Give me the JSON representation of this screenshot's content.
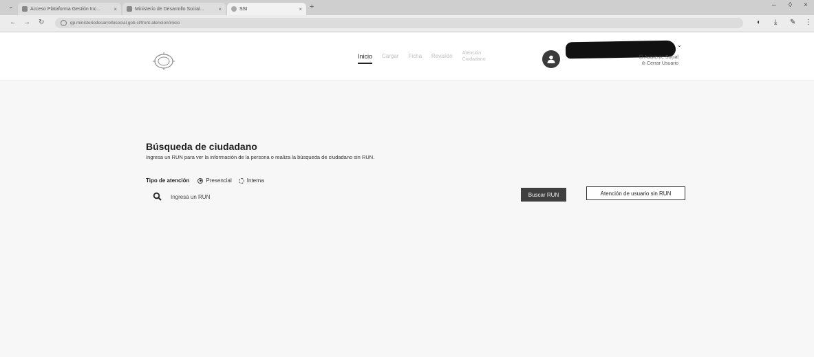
{
  "browser": {
    "tabs": [
      {
        "label": "Acceso Plataforma Gestión Inc..."
      },
      {
        "label": "Ministerio de Desarrollo Social..."
      },
      {
        "label": "SSI"
      }
    ],
    "new_tab": "+",
    "address": "gp.ministeriodesarrollosocial.gob.cl/front-atencion/inicio",
    "window_controls": {
      "minimize": "–",
      "maximize": "◊",
      "close": "×"
    }
  },
  "header": {
    "nav": [
      {
        "label": "Inicio"
      },
      {
        "label": "Cargar"
      },
      {
        "label": "Ficha"
      },
      {
        "label": "Revisión"
      },
      {
        "label_line1": "Atención",
        "label_line2": "Ciudadano"
      }
    ],
    "user_links": [
      "Asistente Social",
      "Cerrar Usuario"
    ]
  },
  "main": {
    "title": "Búsqueda de ciudadano",
    "subtitle": "Ingresa un RUN para ver la información de la persona o realiza la búsqueda de ciudadano sin RUN.",
    "attention_label": "Tipo de atención",
    "options": [
      {
        "label": "Presencial",
        "checked": true
      },
      {
        "label": "Interna",
        "checked": false
      }
    ],
    "search_placeholder": "Ingresa un RUN",
    "search_button": "Buscar RUN",
    "no_run_button": "Atención de usuario sin RUN"
  },
  "colors": {
    "primary_button": "#3f3f3f",
    "page_bg": "#f7f7f7"
  }
}
